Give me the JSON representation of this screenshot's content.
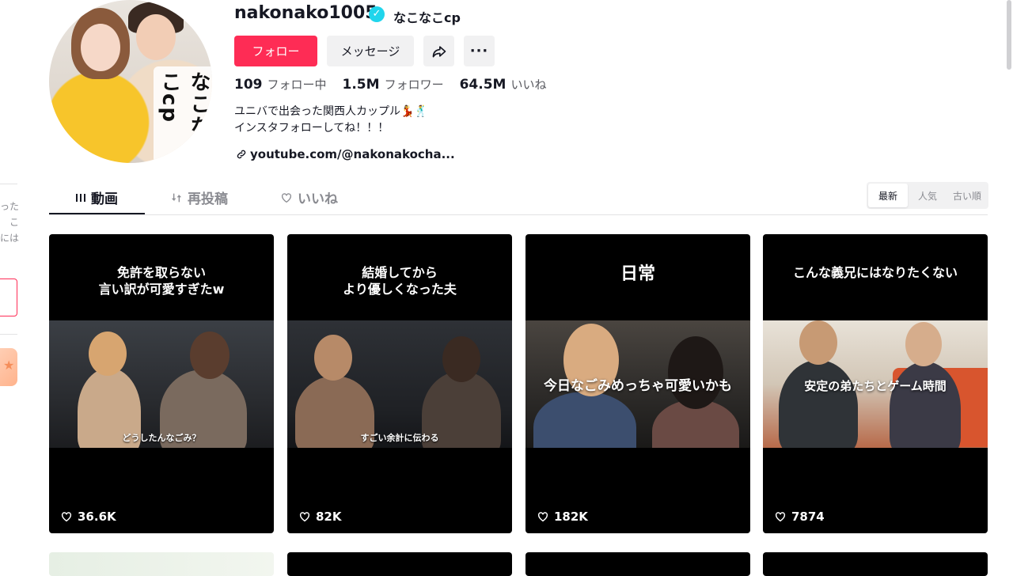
{
  "profile": {
    "username": "nakonako1005",
    "nickname": "なこなこcp",
    "avatar_text": "なこなこcp",
    "verified_glyph": "✓",
    "buttons": {
      "follow": "フォロー",
      "message": "メッセージ",
      "share_icon": "share-icon",
      "more": "···"
    },
    "stats": [
      {
        "value": "109",
        "label": "フォロー中"
      },
      {
        "value": "1.5M",
        "label": "フォロワー"
      },
      {
        "value": "64.5M",
        "label": "いいね"
      }
    ],
    "bio": [
      "ユニバで出会った関西人カップル💃🕺",
      "インスタフォローしてね！！！"
    ],
    "link": "youtube.com/@nakonakocha..."
  },
  "left_sidebar_fragments": [
    "った",
    "こ",
    "には"
  ],
  "tabs": [
    {
      "label": "動画",
      "icon": "grid-icon",
      "active": true
    },
    {
      "label": "再投稿",
      "icon": "repost-icon",
      "active": false
    },
    {
      "label": "いいね",
      "icon": "liked-icon",
      "active": false
    }
  ],
  "sort": {
    "options": [
      "最新",
      "人気",
      "古い順"
    ],
    "selected": "最新"
  },
  "videos": [
    {
      "title": "免許を取らない\n言い訳が可愛すぎたw",
      "subtitle": "どうしたんなごみ？",
      "overlay": "",
      "likes": "36.6K"
    },
    {
      "title": "結婚してから\nより優しくなった夫",
      "subtitle": "すごい余計に伝わる",
      "overlay": "",
      "likes": "82K"
    },
    {
      "title": "日常",
      "subtitle": "",
      "overlay": "今日なごみめっちゃ可愛いかも",
      "likes": "182K"
    },
    {
      "title": "こんな義兄にはなりたくない",
      "subtitle": "",
      "overlay": "安定の弟たちとゲーム時間",
      "likes": "7874"
    }
  ],
  "colors": {
    "accent": "#fe2c55",
    "verified": "#20d5ec",
    "text_primary": "#161823",
    "text_secondary": "#57585e"
  }
}
